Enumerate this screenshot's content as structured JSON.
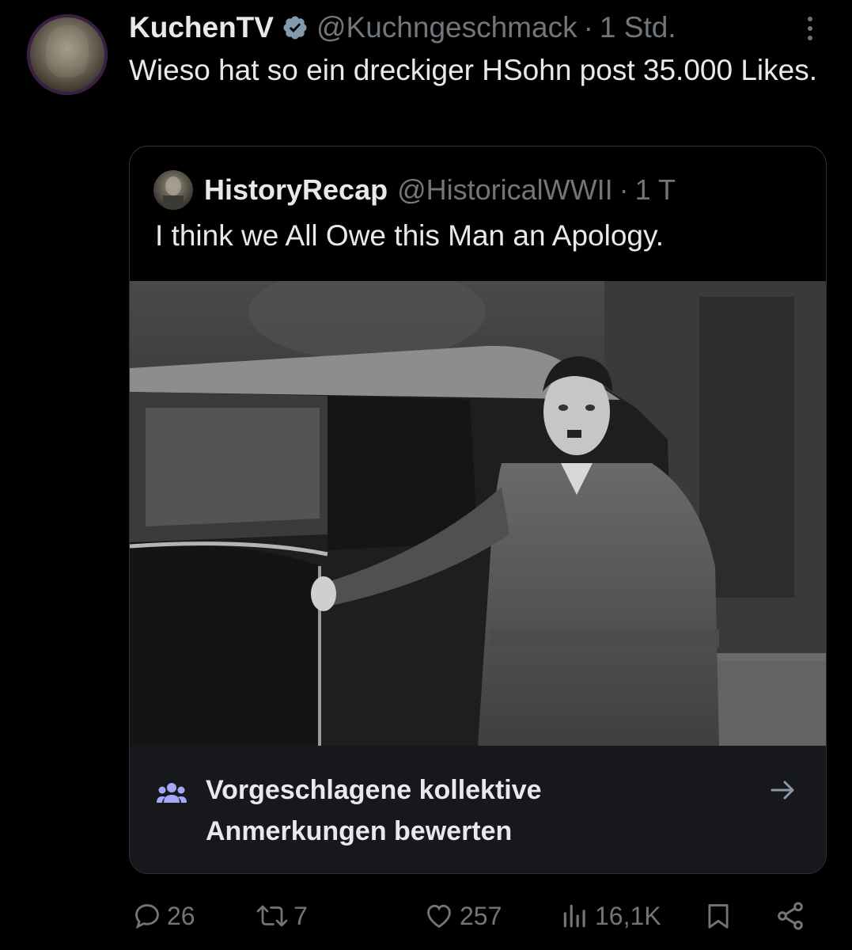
{
  "post": {
    "author_name": "KuchenTV",
    "author_handle": "@Kuchngeschmack",
    "separator": "·",
    "time": "1 Std.",
    "text": "Wieso hat so ein dreckiger HSohn post 35.000 Likes.",
    "verified": true
  },
  "quoted_post": {
    "author_name": "HistoryRecap",
    "author_handle": "@HistoricalWWII",
    "separator": "·",
    "time": "1 T",
    "text": "I think we All Owe this Man an Apology.",
    "media": "black-and-white historical photograph of a man in a coat standing beside a vintage car"
  },
  "community_notes": {
    "label": "Vorgeschlagene kollektive Anmerkungen bewerten",
    "icon": "people-icon",
    "accent_color": "#a5a8f5"
  },
  "actions": {
    "replies": "26",
    "reposts": "7",
    "likes": "257",
    "views": "16,1K"
  },
  "colors": {
    "background": "#000000",
    "text": "#e7e9ea",
    "secondary": "#71767b",
    "verified_badge": "#829aab",
    "border": "#2f3336"
  }
}
